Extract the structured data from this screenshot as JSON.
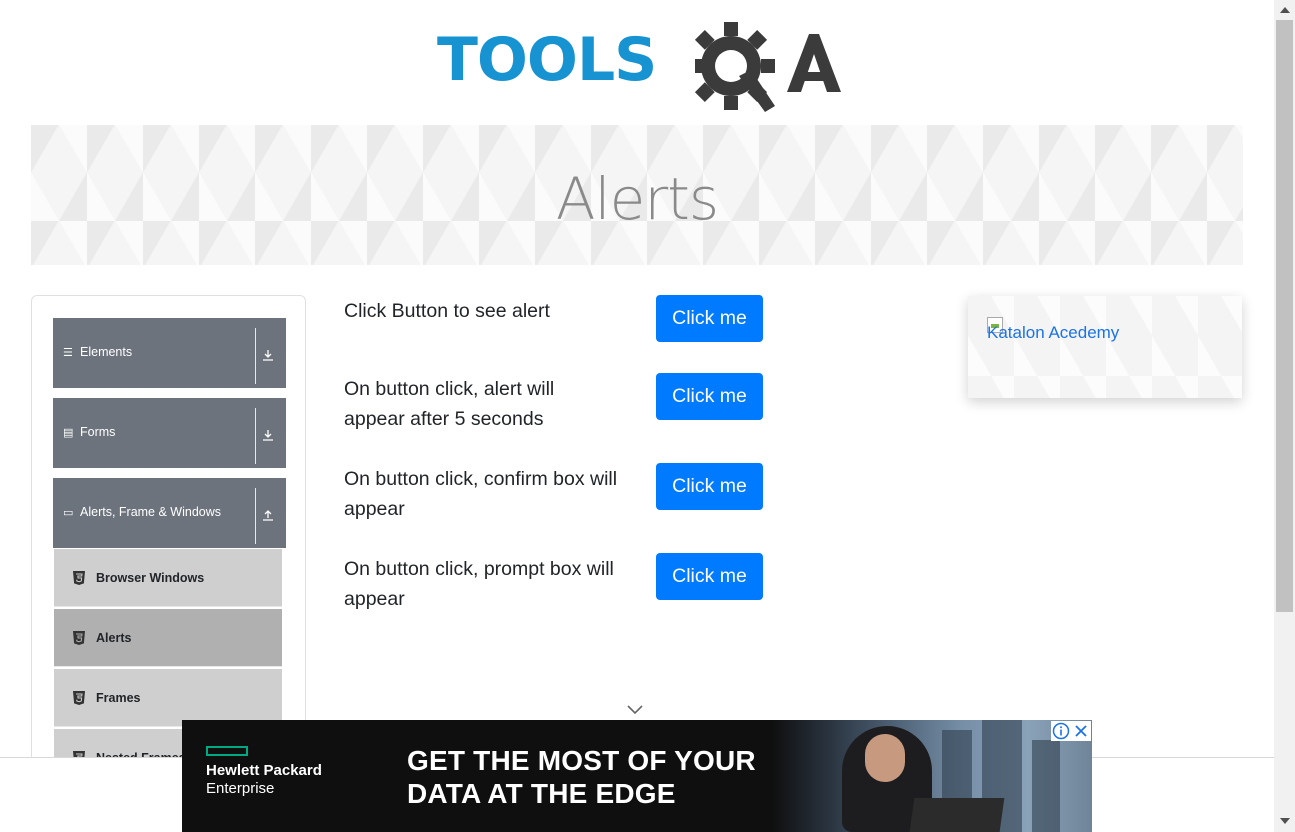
{
  "logo": {
    "text_tools": "TOOLS",
    "text_qa": "QA",
    "colors": {
      "tools": "#1793d2",
      "qa": "#3b3b3b"
    }
  },
  "banner": {
    "title": "Alerts"
  },
  "sidebar": {
    "groups": [
      {
        "label": "Elements",
        "icon": "hamburger-icon",
        "arrow": "download-arrow-icon"
      },
      {
        "label": "Forms",
        "icon": "form-icon",
        "arrow": "download-arrow-icon"
      },
      {
        "label": "Alerts, Frame & Windows",
        "icon": "window-icon",
        "arrow": "upload-arrow-icon"
      }
    ],
    "items": [
      {
        "label": "Browser Windows",
        "icon": "html5-icon",
        "active": false
      },
      {
        "label": "Alerts",
        "icon": "html5-icon",
        "active": true
      },
      {
        "label": "Frames",
        "icon": "html5-icon",
        "active": false
      },
      {
        "label": "Nested Frames",
        "icon": "html5-icon",
        "active": false
      }
    ]
  },
  "alerts": [
    {
      "text": "Click Button to see alert",
      "button": "Click me"
    },
    {
      "text": "On button click, alert will appear after 5 seconds",
      "button": "Click me"
    },
    {
      "text": "On button click, confirm box will appear",
      "button": "Click me"
    },
    {
      "text": "On button click, prompt box will appear",
      "button": "Click me"
    }
  ],
  "right_ad": {
    "alt_text": "Katalon Acedemy"
  },
  "bottom_ad": {
    "brand_line1": "Hewlett Packard",
    "brand_line2": "Enterprise",
    "headline_line1": "GET THE MOST OF YOUR",
    "headline_line2": "DATA AT THE EDGE",
    "brand_color": "#01a982"
  },
  "colors": {
    "primary_button": "#007bff",
    "sidebar_group": "#6c737d",
    "sidebar_item": "#cfcfcf",
    "sidebar_item_active": "#b0b0b0"
  }
}
